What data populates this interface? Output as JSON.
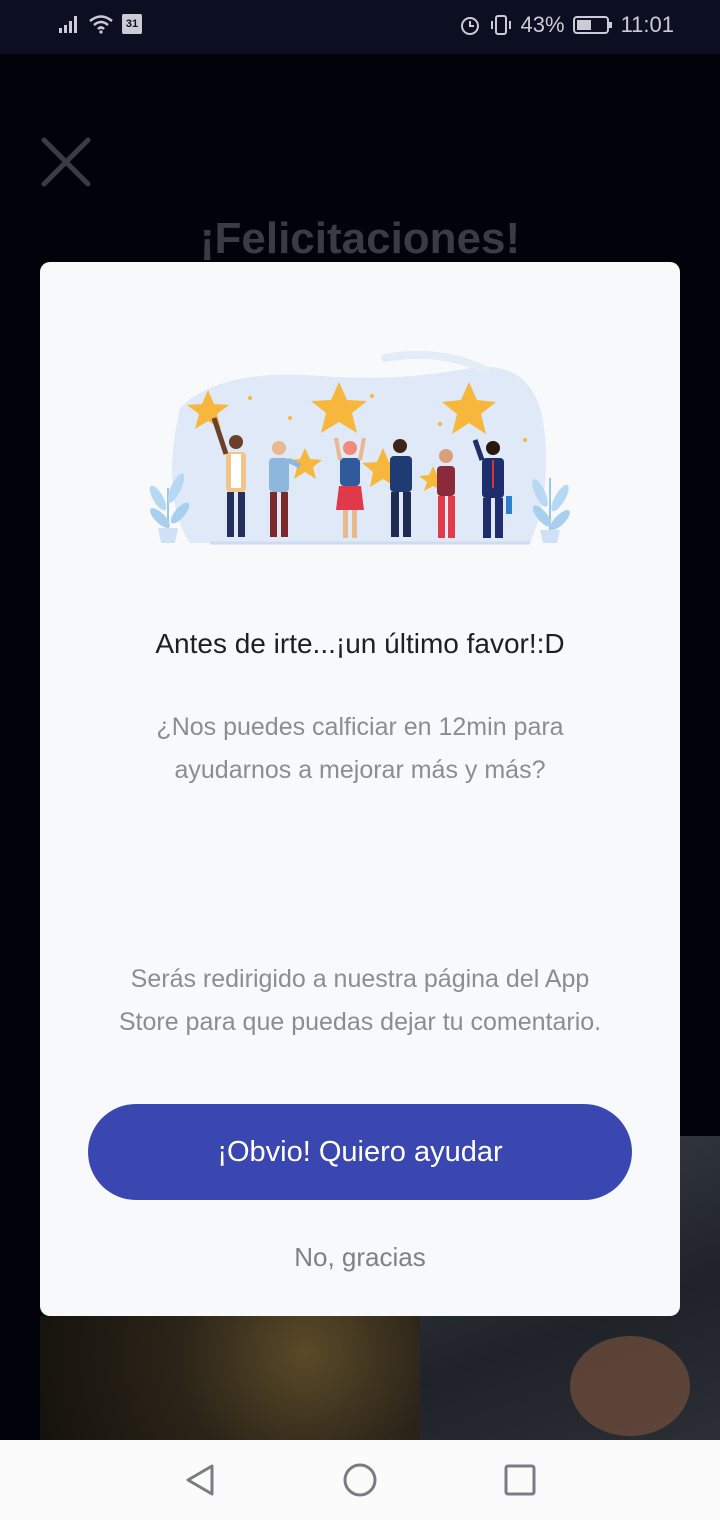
{
  "status_bar": {
    "calendar_day": "31",
    "battery": "43%",
    "time": "11:01",
    "icons": [
      "signal-icon",
      "wifi-icon",
      "calendar-icon",
      "alarm-icon",
      "vibrate-icon",
      "battery-icon"
    ]
  },
  "background": {
    "title": "¡Felicitaciones!",
    "close_icon": "close-icon"
  },
  "dialog": {
    "illustration": "people-holding-stars-illustration",
    "title": "Antes de irte...¡un último favor!:D",
    "question": "¿Nos puedes calficiar en 12min para ayudarnos a mejorar más y más?",
    "note": "Serás redirigido a nuestra página del App Store para que puedas dejar tu comentario.",
    "primary_button": "¡Obvio! Quiero ayudar",
    "secondary_button": "No, gracias"
  },
  "nav_bar": {
    "icons": [
      "back-icon",
      "home-icon",
      "recents-icon"
    ]
  },
  "colors": {
    "primary": "#3a47b0",
    "star": "#f6b73c",
    "dialog_bg": "#f8f9fb",
    "backdrop": "#02030a"
  }
}
